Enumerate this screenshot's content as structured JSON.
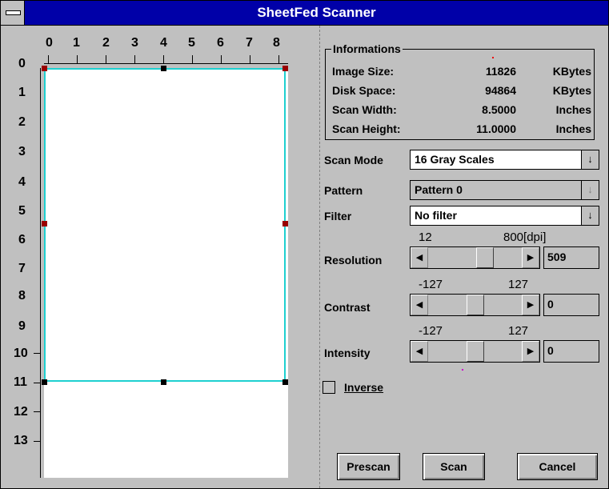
{
  "window": {
    "title": "SheetFed Scanner"
  },
  "ruler": {
    "horizontal": [
      "0",
      "1",
      "2",
      "3",
      "4",
      "5",
      "6",
      "7",
      "8"
    ],
    "vertical": [
      "0",
      "1",
      "2",
      "3",
      "4",
      "5",
      "6",
      "7",
      "8",
      "9",
      "10",
      "11",
      "12",
      "13"
    ]
  },
  "info": {
    "group_label": "Informations",
    "rows": [
      {
        "label": "Image Size:",
        "value": "11826",
        "unit": "KBytes"
      },
      {
        "label": "Disk Space:",
        "value": "94864",
        "unit": "KBytes"
      },
      {
        "label": "Scan Width:",
        "value": "8.5000",
        "unit": "Inches"
      },
      {
        "label": "Scan Height:",
        "value": "11.0000",
        "unit": "Inches"
      }
    ]
  },
  "scan_mode": {
    "label": "Scan Mode",
    "value": "16 Gray Scales"
  },
  "pattern": {
    "label": "Pattern",
    "value": "Pattern 0"
  },
  "filter": {
    "label": "Filter",
    "value": "No filter"
  },
  "resolution": {
    "label": "Resolution",
    "min": "12",
    "max": "800[dpi]",
    "value": "509"
  },
  "contrast": {
    "label": "Contrast",
    "min": "-127",
    "max": "127",
    "value": "0"
  },
  "intensity": {
    "label": "Intensity",
    "min": "-127",
    "max": "127",
    "value": "0"
  },
  "inverse": {
    "label": "Inverse",
    "checked": false
  },
  "buttons": {
    "prescan": "Prescan",
    "scan": "Scan",
    "cancel": "Cancel"
  }
}
